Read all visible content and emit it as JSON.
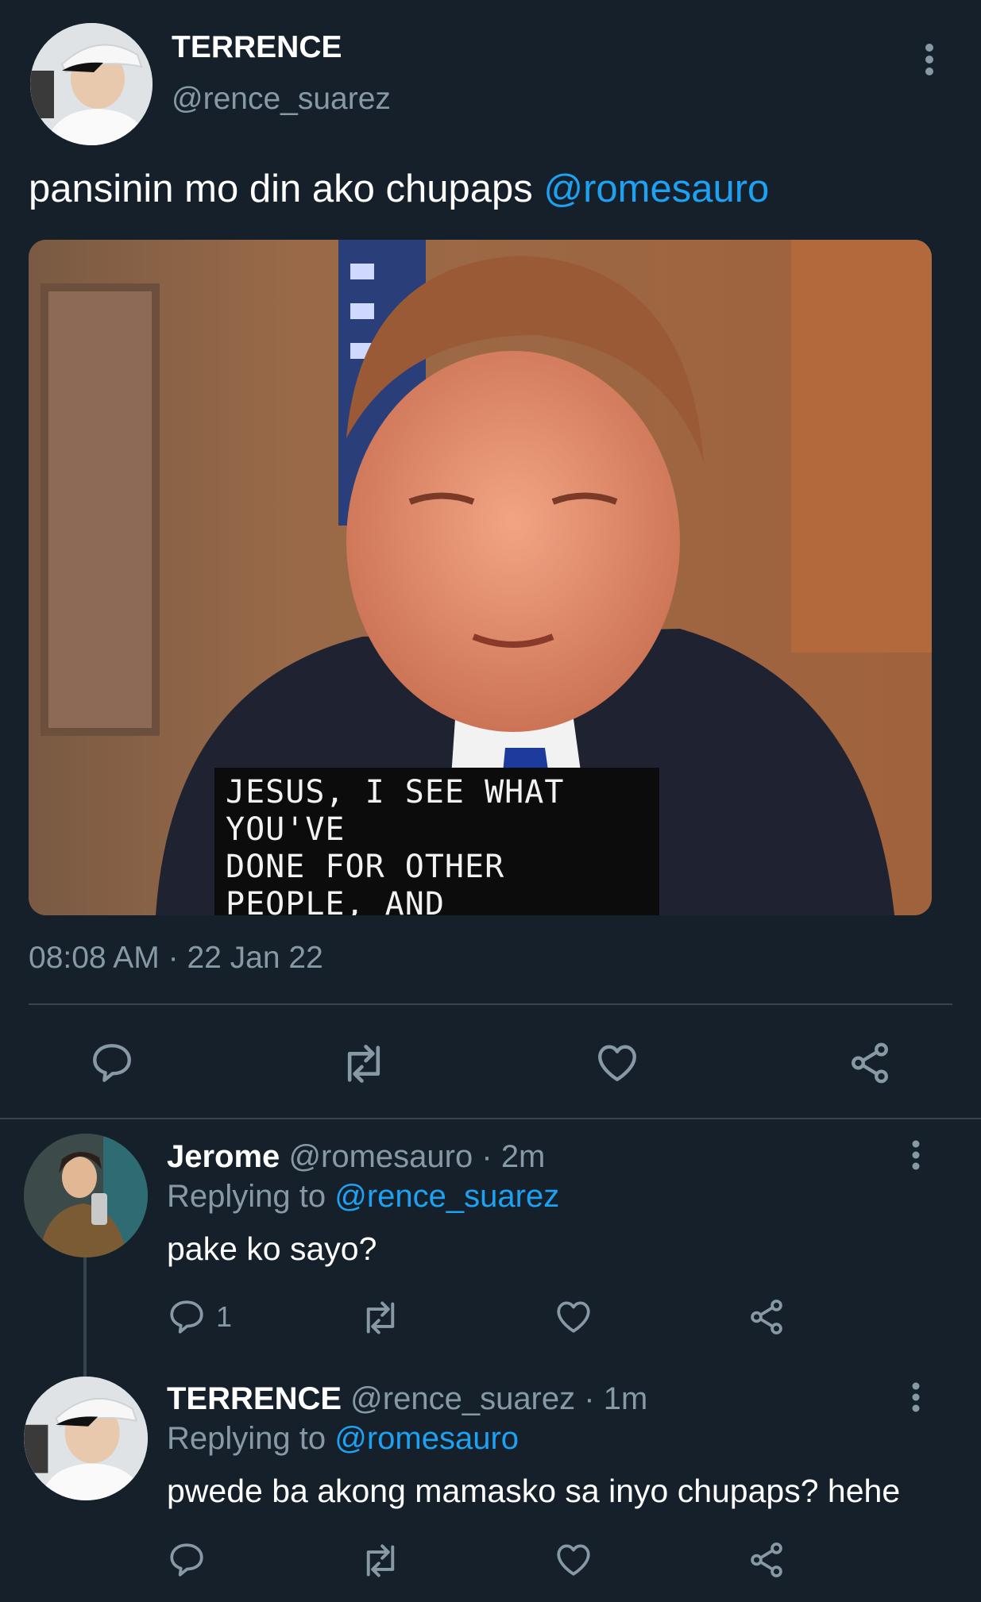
{
  "tweet": {
    "display_name": "TERRENCE",
    "handle": "@rence_suarez",
    "text": "pansinin mo din ako chupaps ",
    "mention": "@romesauro",
    "meme_caption": "JESUS, I SEE WHAT YOU'VE\nDONE FOR OTHER PEOPLE, AND\nI WANT THAT FOR ME.",
    "time": "08:08 AM",
    "sep": "·",
    "date": "22 Jan 22"
  },
  "replies": [
    {
      "display_name": "Jerome",
      "handle": "@romesauro",
      "sep": "·",
      "age": "2m",
      "replying_prefix": "Replying to ",
      "replying_to": "@rence_suarez",
      "text": "pake ko sayo?",
      "reply_count": "1"
    },
    {
      "display_name": "TERRENCE",
      "handle": "@rence_suarez",
      "sep": "·",
      "age": "1m",
      "replying_prefix": "Replying to ",
      "replying_to": "@romesauro",
      "text": "pwede ba akong mamasko sa inyo chupaps? hehe",
      "reply_count": ""
    }
  ],
  "colors": {
    "background": "#15202b",
    "text": "#ffffff",
    "muted": "#8899a6",
    "link": "#1da1f2",
    "divider": "#38444d"
  },
  "icons": [
    "more-options-icon",
    "reply-icon",
    "retweet-icon",
    "like-icon",
    "share-icon"
  ]
}
